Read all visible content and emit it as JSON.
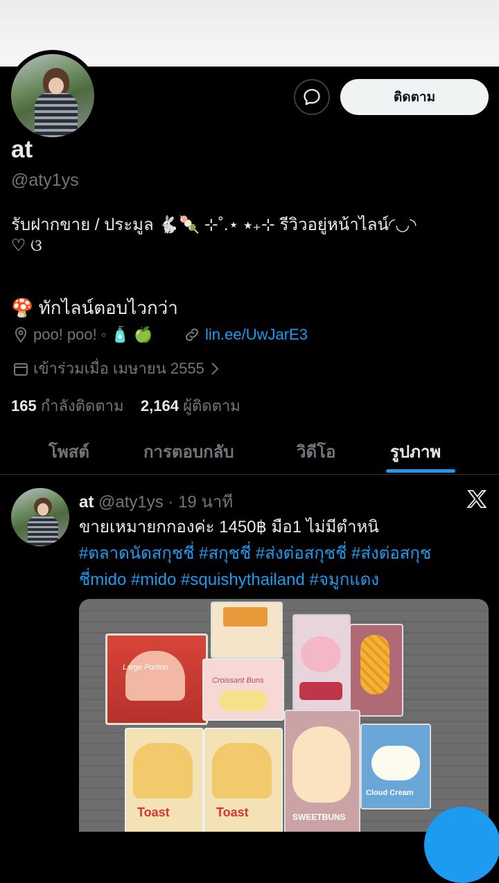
{
  "profile": {
    "display_name": "at",
    "handle": "@aty1ys",
    "bio_line1": "รับฝากขาย / ประมูล 🐇🍡 ⊹˚.⋆ ⭑₊⊹ รีวิวอยู่หน้าไลน์◜◡◝",
    "bio_line2": "♡ ଓ",
    "bio_line3": "🍄 ทักไลน์ตอบไวกว่า",
    "location": "poo! poo! ◦ 🧴 🍏",
    "link": "lin.ee/UwJarE3",
    "joined": "เข้าร่วมเมื่อ เมษายน 2555",
    "following_count": "165",
    "following_label": "กำลังติดตาม",
    "followers_count": "2,164",
    "followers_label": "ผู้ติดตาม"
  },
  "actions": {
    "follow_label": "ติดตาม"
  },
  "tabs": [
    {
      "label": "โพสต์"
    },
    {
      "label": "การตอบกลับ"
    },
    {
      "label": "วิดีโอ"
    },
    {
      "label": "รูปภาพ",
      "active": true
    }
  ],
  "post": {
    "name": "at",
    "handle": "@aty1ys",
    "time": "· 19 นาที",
    "text": "ขายเหมายกกองค่ะ 1450฿ มือ1 ไม่มีตำหนิ",
    "hashtags_line1": "#ตลาดนัดสกุชชี่ #สกุชชี่ #ส่งต่อสกุชชี่ #ส่งต่อสกุช",
    "hashtags_line2": "ชี่mido #mido #squishythailand #จมูกแดง"
  },
  "photo_labels": {
    "toast": "Toast",
    "sweetbuns": "SWEETBUNS",
    "cloud_cream": "Cloud Cream",
    "large_portion": "Large Portion",
    "croissant": "Croissant Buns"
  },
  "icons": [
    "message-icon",
    "location-icon",
    "link-icon",
    "calendar-icon",
    "chevron-right-icon",
    "x-logo-icon",
    "compose-fab-icon"
  ],
  "colors": {
    "accent": "#1d9bf0",
    "muted": "#71767b",
    "text": "#e7e9ea",
    "background": "#000000"
  }
}
